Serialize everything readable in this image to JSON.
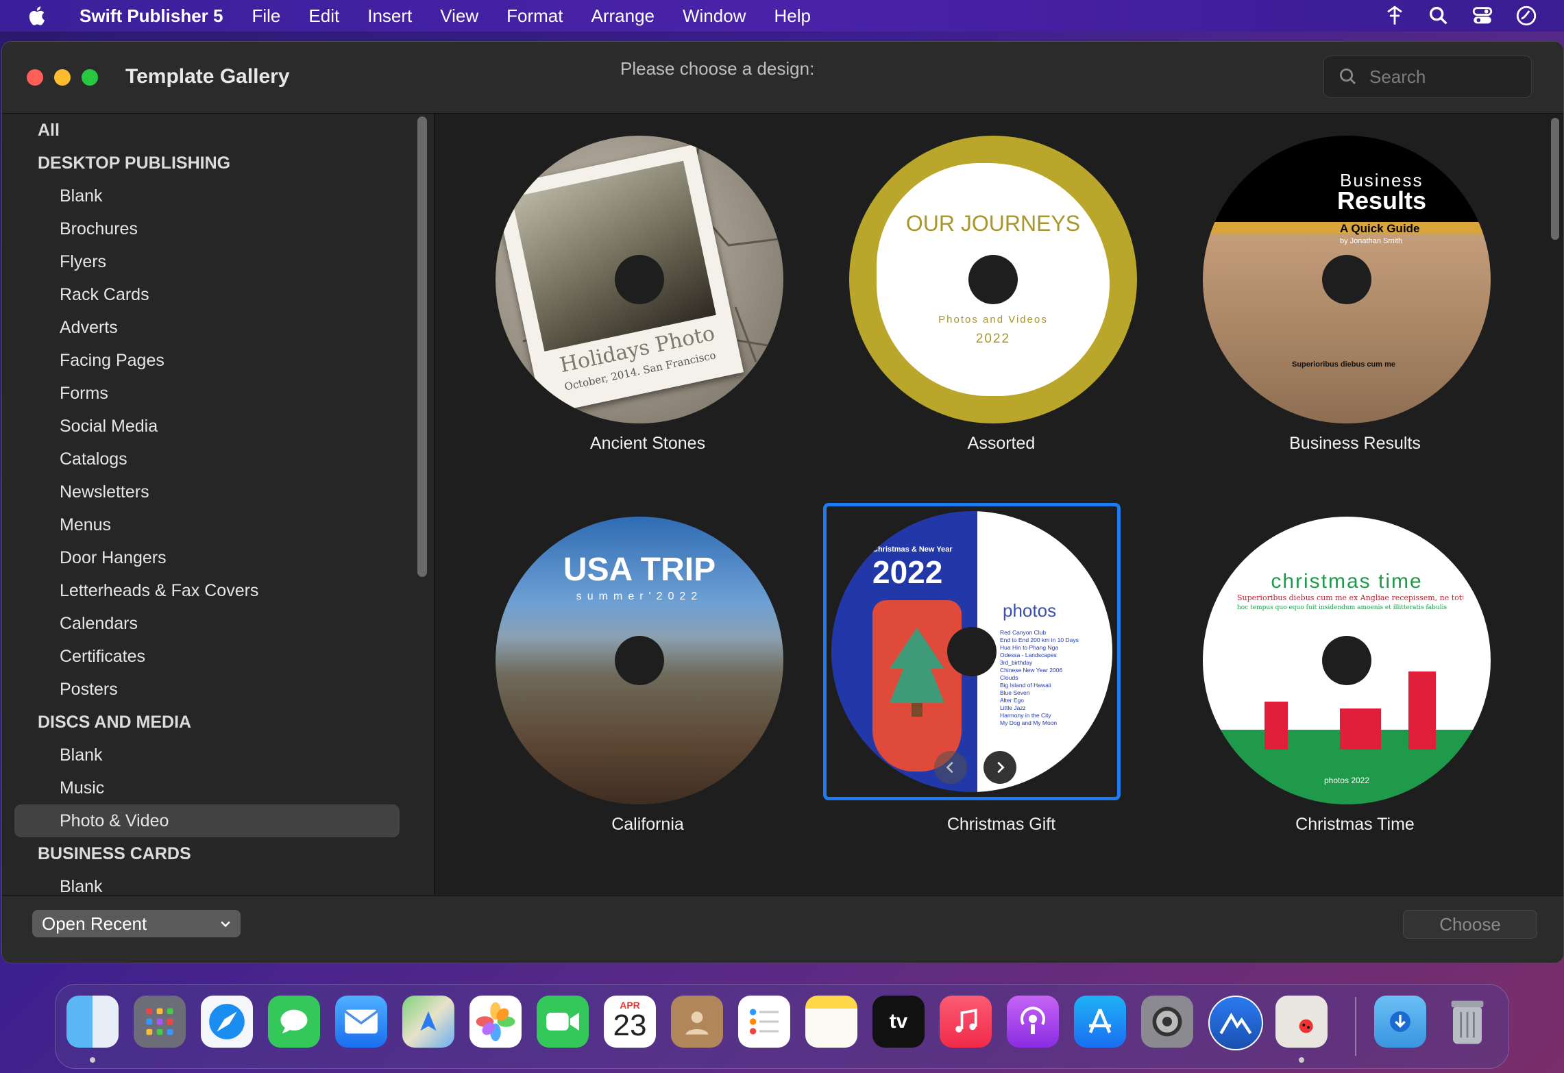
{
  "menubar": {
    "app_name": "Swift Publisher 5",
    "items": [
      "File",
      "Edit",
      "Insert",
      "View",
      "Format",
      "Arrange",
      "Window",
      "Help"
    ],
    "right_icons": [
      "status-icon",
      "search-icon",
      "control-center-icon",
      "siri-icon"
    ]
  },
  "window": {
    "title": "Template Gallery",
    "subtitle": "Please choose a design:",
    "search_placeholder": "Search"
  },
  "sidebar": {
    "all": "All",
    "sections": [
      {
        "header": "DESKTOP PUBLISHING",
        "items": [
          "Blank",
          "Brochures",
          "Flyers",
          "Rack Cards",
          "Adverts",
          "Facing Pages",
          "Forms",
          "Social Media",
          "Catalogs",
          "Newsletters",
          "Menus",
          "Door Hangers",
          "Letterheads & Fax Covers",
          "Calendars",
          "Certificates",
          "Posters"
        ]
      },
      {
        "header": "DISCS AND MEDIA",
        "items": [
          "Blank",
          "Music",
          "Photo & Video"
        ]
      },
      {
        "header": "BUSINESS CARDS",
        "items": [
          "Blank"
        ]
      }
    ],
    "selected": "Photo & Video"
  },
  "templates": [
    {
      "name": "Ancient Stones",
      "disc_text": [
        "Holidays Photo",
        "October, 2014. San Francisco"
      ]
    },
    {
      "name": "Assorted",
      "disc_text": [
        "OUR JOURNEYS",
        "Photos and Videos",
        "2022"
      ]
    },
    {
      "name": "Business Results",
      "disc_text": [
        "Business",
        "Results",
        "A Quick Guide",
        "by Jonathan Smith",
        "Superioribus diebus cum me"
      ]
    },
    {
      "name": "California",
      "disc_text": [
        "USA TRIP",
        "summer'2022"
      ]
    },
    {
      "name": "Christmas Gift",
      "disc_text": [
        "Christmas & New Year",
        "2022",
        "photos",
        "Red Canyon Club",
        "End to End 200 km in 10 Days",
        "Hua Hin to Phang Nga",
        "Odessa - Landscapes",
        "3rd_birthday",
        "Chinese New Year 2006",
        "Clouds",
        "Big Island of Hawaii",
        "Blue Seven",
        "Alter Ego",
        "Little Jazz",
        "Harmony in the City",
        "My Dog and My Moon"
      ]
    },
    {
      "name": "Christmas Time",
      "disc_text": [
        "christmas time",
        "Superioribus diebus cum me ex Angliae recepissem, ne totum",
        "hoc tempus quo equo fuit insidendum amoenis et illitteratis fabulis",
        "photos 2022"
      ]
    }
  ],
  "selected_template": "Christmas Gift",
  "bottom": {
    "open_recent": "Open Recent",
    "choose": "Choose"
  },
  "dock": {
    "calendar_month": "APR",
    "calendar_day": "23",
    "tv_label": "tv",
    "apps": [
      "finder-icon",
      "launchpad-icon",
      "safari-icon",
      "messages-icon",
      "mail-icon",
      "maps-icon",
      "photos-icon",
      "facetime-icon",
      "calendar-icon",
      "contacts-icon",
      "reminders-icon",
      "notes-icon",
      "tv-icon",
      "music-icon",
      "podcasts-icon",
      "app-store-icon",
      "system-preferences-icon",
      "affinity-icon",
      "swift-publisher-icon",
      "downloads-icon",
      "trash-icon"
    ]
  },
  "colors": {
    "accent": "#1f7bf2",
    "window_bg": "#1e1e1e",
    "sidebar_bg": "#262626",
    "selected_row": "#434343"
  }
}
